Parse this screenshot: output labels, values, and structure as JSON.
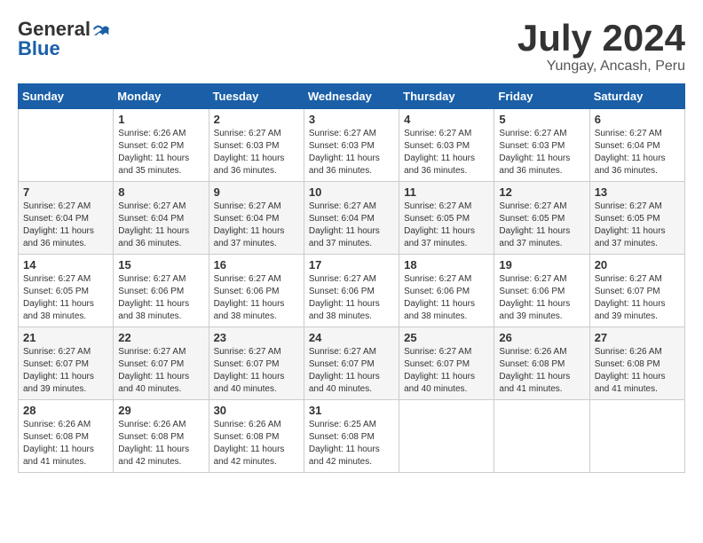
{
  "logo": {
    "general": "General",
    "blue": "Blue"
  },
  "title": "July 2024",
  "location": "Yungay, Ancash, Peru",
  "days_of_week": [
    "Sunday",
    "Monday",
    "Tuesday",
    "Wednesday",
    "Thursday",
    "Friday",
    "Saturday"
  ],
  "weeks": [
    [
      {
        "day": "",
        "sunrise": "",
        "sunset": "",
        "daylight": ""
      },
      {
        "day": "1",
        "sunrise": "Sunrise: 6:26 AM",
        "sunset": "Sunset: 6:02 PM",
        "daylight": "Daylight: 11 hours and 35 minutes."
      },
      {
        "day": "2",
        "sunrise": "Sunrise: 6:27 AM",
        "sunset": "Sunset: 6:03 PM",
        "daylight": "Daylight: 11 hours and 36 minutes."
      },
      {
        "day": "3",
        "sunrise": "Sunrise: 6:27 AM",
        "sunset": "Sunset: 6:03 PM",
        "daylight": "Daylight: 11 hours and 36 minutes."
      },
      {
        "day": "4",
        "sunrise": "Sunrise: 6:27 AM",
        "sunset": "Sunset: 6:03 PM",
        "daylight": "Daylight: 11 hours and 36 minutes."
      },
      {
        "day": "5",
        "sunrise": "Sunrise: 6:27 AM",
        "sunset": "Sunset: 6:03 PM",
        "daylight": "Daylight: 11 hours and 36 minutes."
      },
      {
        "day": "6",
        "sunrise": "Sunrise: 6:27 AM",
        "sunset": "Sunset: 6:04 PM",
        "daylight": "Daylight: 11 hours and 36 minutes."
      }
    ],
    [
      {
        "day": "7",
        "sunrise": "Sunrise: 6:27 AM",
        "sunset": "Sunset: 6:04 PM",
        "daylight": "Daylight: 11 hours and 36 minutes."
      },
      {
        "day": "8",
        "sunrise": "Sunrise: 6:27 AM",
        "sunset": "Sunset: 6:04 PM",
        "daylight": "Daylight: 11 hours and 36 minutes."
      },
      {
        "day": "9",
        "sunrise": "Sunrise: 6:27 AM",
        "sunset": "Sunset: 6:04 PM",
        "daylight": "Daylight: 11 hours and 37 minutes."
      },
      {
        "day": "10",
        "sunrise": "Sunrise: 6:27 AM",
        "sunset": "Sunset: 6:04 PM",
        "daylight": "Daylight: 11 hours and 37 minutes."
      },
      {
        "day": "11",
        "sunrise": "Sunrise: 6:27 AM",
        "sunset": "Sunset: 6:05 PM",
        "daylight": "Daylight: 11 hours and 37 minutes."
      },
      {
        "day": "12",
        "sunrise": "Sunrise: 6:27 AM",
        "sunset": "Sunset: 6:05 PM",
        "daylight": "Daylight: 11 hours and 37 minutes."
      },
      {
        "day": "13",
        "sunrise": "Sunrise: 6:27 AM",
        "sunset": "Sunset: 6:05 PM",
        "daylight": "Daylight: 11 hours and 37 minutes."
      }
    ],
    [
      {
        "day": "14",
        "sunrise": "Sunrise: 6:27 AM",
        "sunset": "Sunset: 6:05 PM",
        "daylight": "Daylight: 11 hours and 38 minutes."
      },
      {
        "day": "15",
        "sunrise": "Sunrise: 6:27 AM",
        "sunset": "Sunset: 6:06 PM",
        "daylight": "Daylight: 11 hours and 38 minutes."
      },
      {
        "day": "16",
        "sunrise": "Sunrise: 6:27 AM",
        "sunset": "Sunset: 6:06 PM",
        "daylight": "Daylight: 11 hours and 38 minutes."
      },
      {
        "day": "17",
        "sunrise": "Sunrise: 6:27 AM",
        "sunset": "Sunset: 6:06 PM",
        "daylight": "Daylight: 11 hours and 38 minutes."
      },
      {
        "day": "18",
        "sunrise": "Sunrise: 6:27 AM",
        "sunset": "Sunset: 6:06 PM",
        "daylight": "Daylight: 11 hours and 38 minutes."
      },
      {
        "day": "19",
        "sunrise": "Sunrise: 6:27 AM",
        "sunset": "Sunset: 6:06 PM",
        "daylight": "Daylight: 11 hours and 39 minutes."
      },
      {
        "day": "20",
        "sunrise": "Sunrise: 6:27 AM",
        "sunset": "Sunset: 6:07 PM",
        "daylight": "Daylight: 11 hours and 39 minutes."
      }
    ],
    [
      {
        "day": "21",
        "sunrise": "Sunrise: 6:27 AM",
        "sunset": "Sunset: 6:07 PM",
        "daylight": "Daylight: 11 hours and 39 minutes."
      },
      {
        "day": "22",
        "sunrise": "Sunrise: 6:27 AM",
        "sunset": "Sunset: 6:07 PM",
        "daylight": "Daylight: 11 hours and 40 minutes."
      },
      {
        "day": "23",
        "sunrise": "Sunrise: 6:27 AM",
        "sunset": "Sunset: 6:07 PM",
        "daylight": "Daylight: 11 hours and 40 minutes."
      },
      {
        "day": "24",
        "sunrise": "Sunrise: 6:27 AM",
        "sunset": "Sunset: 6:07 PM",
        "daylight": "Daylight: 11 hours and 40 minutes."
      },
      {
        "day": "25",
        "sunrise": "Sunrise: 6:27 AM",
        "sunset": "Sunset: 6:07 PM",
        "daylight": "Daylight: 11 hours and 40 minutes."
      },
      {
        "day": "26",
        "sunrise": "Sunrise: 6:26 AM",
        "sunset": "Sunset: 6:08 PM",
        "daylight": "Daylight: 11 hours and 41 minutes."
      },
      {
        "day": "27",
        "sunrise": "Sunrise: 6:26 AM",
        "sunset": "Sunset: 6:08 PM",
        "daylight": "Daylight: 11 hours and 41 minutes."
      }
    ],
    [
      {
        "day": "28",
        "sunrise": "Sunrise: 6:26 AM",
        "sunset": "Sunset: 6:08 PM",
        "daylight": "Daylight: 11 hours and 41 minutes."
      },
      {
        "day": "29",
        "sunrise": "Sunrise: 6:26 AM",
        "sunset": "Sunset: 6:08 PM",
        "daylight": "Daylight: 11 hours and 42 minutes."
      },
      {
        "day": "30",
        "sunrise": "Sunrise: 6:26 AM",
        "sunset": "Sunset: 6:08 PM",
        "daylight": "Daylight: 11 hours and 42 minutes."
      },
      {
        "day": "31",
        "sunrise": "Sunrise: 6:25 AM",
        "sunset": "Sunset: 6:08 PM",
        "daylight": "Daylight: 11 hours and 42 minutes."
      },
      {
        "day": "",
        "sunrise": "",
        "sunset": "",
        "daylight": ""
      },
      {
        "day": "",
        "sunrise": "",
        "sunset": "",
        "daylight": ""
      },
      {
        "day": "",
        "sunrise": "",
        "sunset": "",
        "daylight": ""
      }
    ]
  ]
}
